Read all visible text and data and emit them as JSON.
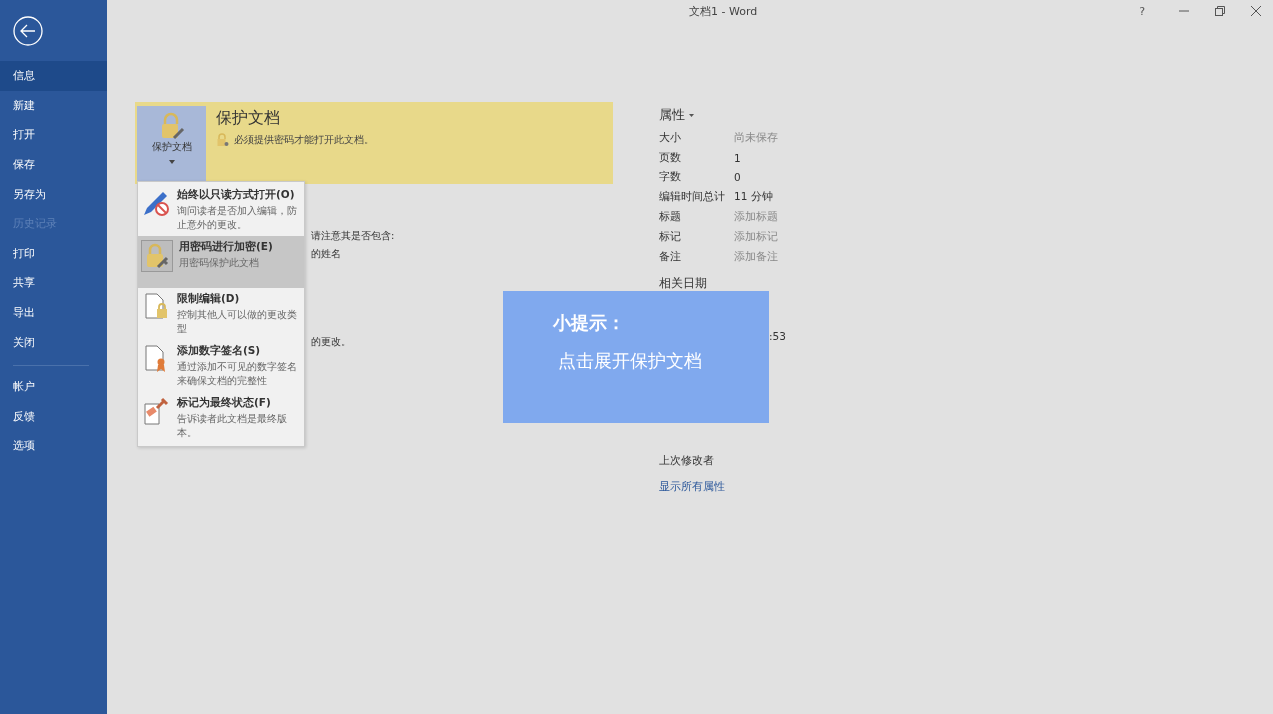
{
  "window": {
    "title": "文档1  -  Word",
    "help": "?"
  },
  "sidebar": {
    "items": [
      {
        "label": "信息",
        "selected": true,
        "disabled": false
      },
      {
        "label": "新建",
        "selected": false,
        "disabled": false
      },
      {
        "label": "打开",
        "selected": false,
        "disabled": false
      },
      {
        "label": "保存",
        "selected": false,
        "disabled": false
      },
      {
        "label": "另存为",
        "selected": false,
        "disabled": false
      },
      {
        "label": "历史记录",
        "selected": false,
        "disabled": true
      },
      {
        "label": "打印",
        "selected": false,
        "disabled": false
      },
      {
        "label": "共享",
        "selected": false,
        "disabled": false
      },
      {
        "label": "导出",
        "selected": false,
        "disabled": false
      },
      {
        "label": "关闭",
        "selected": false,
        "disabled": false
      }
    ],
    "footer_items": [
      {
        "label": "帐户",
        "selected": false,
        "disabled": false
      },
      {
        "label": "反馈",
        "selected": false,
        "disabled": false
      },
      {
        "label": "选项",
        "selected": false,
        "disabled": false
      }
    ]
  },
  "protect": {
    "button_label": "保护文档",
    "expanded": true,
    "title": "保护文档",
    "message": "必须提供密码才能打开此文档。",
    "menu": [
      {
        "kind": "pencil-block",
        "title": "始终以只读方式打开(O)",
        "description": "询问读者是否加入编辑，防止意外的更改。",
        "selected": false
      },
      {
        "kind": "lock-key",
        "title": "用密码进行加密(E)",
        "description": "用密码保护此文档",
        "selected": true
      },
      {
        "kind": "doc-lock",
        "title": "限制编辑(D)",
        "description": "控制其他人可以做的更改类型",
        "selected": false
      },
      {
        "kind": "doc-ribbon",
        "title": "添加数字签名(S)",
        "description": "通过添加不可见的数字签名来确保文档的完整性",
        "selected": false
      },
      {
        "kind": "doc-stamp",
        "title": "标记为最终状态(F)",
        "description": "告诉读者此文档是最终版本。",
        "selected": false
      }
    ]
  },
  "covered_text": [
    "请注意其是否包含:",
    "的姓名",
    "的更改。"
  ],
  "properties": {
    "title": "属性",
    "rows": [
      {
        "label": "大小",
        "value": "尚未保存",
        "muted": true
      },
      {
        "label": "页数",
        "value": "1",
        "muted": false
      },
      {
        "label": "字数",
        "value": "0",
        "muted": false
      },
      {
        "label": "编辑时间总计",
        "value": "11 分钟",
        "muted": false
      },
      {
        "label": "标题",
        "value": "添加标题",
        "muted": true
      },
      {
        "label": "标记",
        "value": "添加标记",
        "muted": true
      },
      {
        "label": "备注",
        "value": "添加备注",
        "muted": true
      }
    ],
    "dates_title": "相关日期",
    "date_value": ":53",
    "last_modified_label": "上次修改者",
    "show_all_link": "显示所有属性"
  },
  "tip": {
    "heading": "小提示：",
    "text": "点击展开保护文档"
  }
}
